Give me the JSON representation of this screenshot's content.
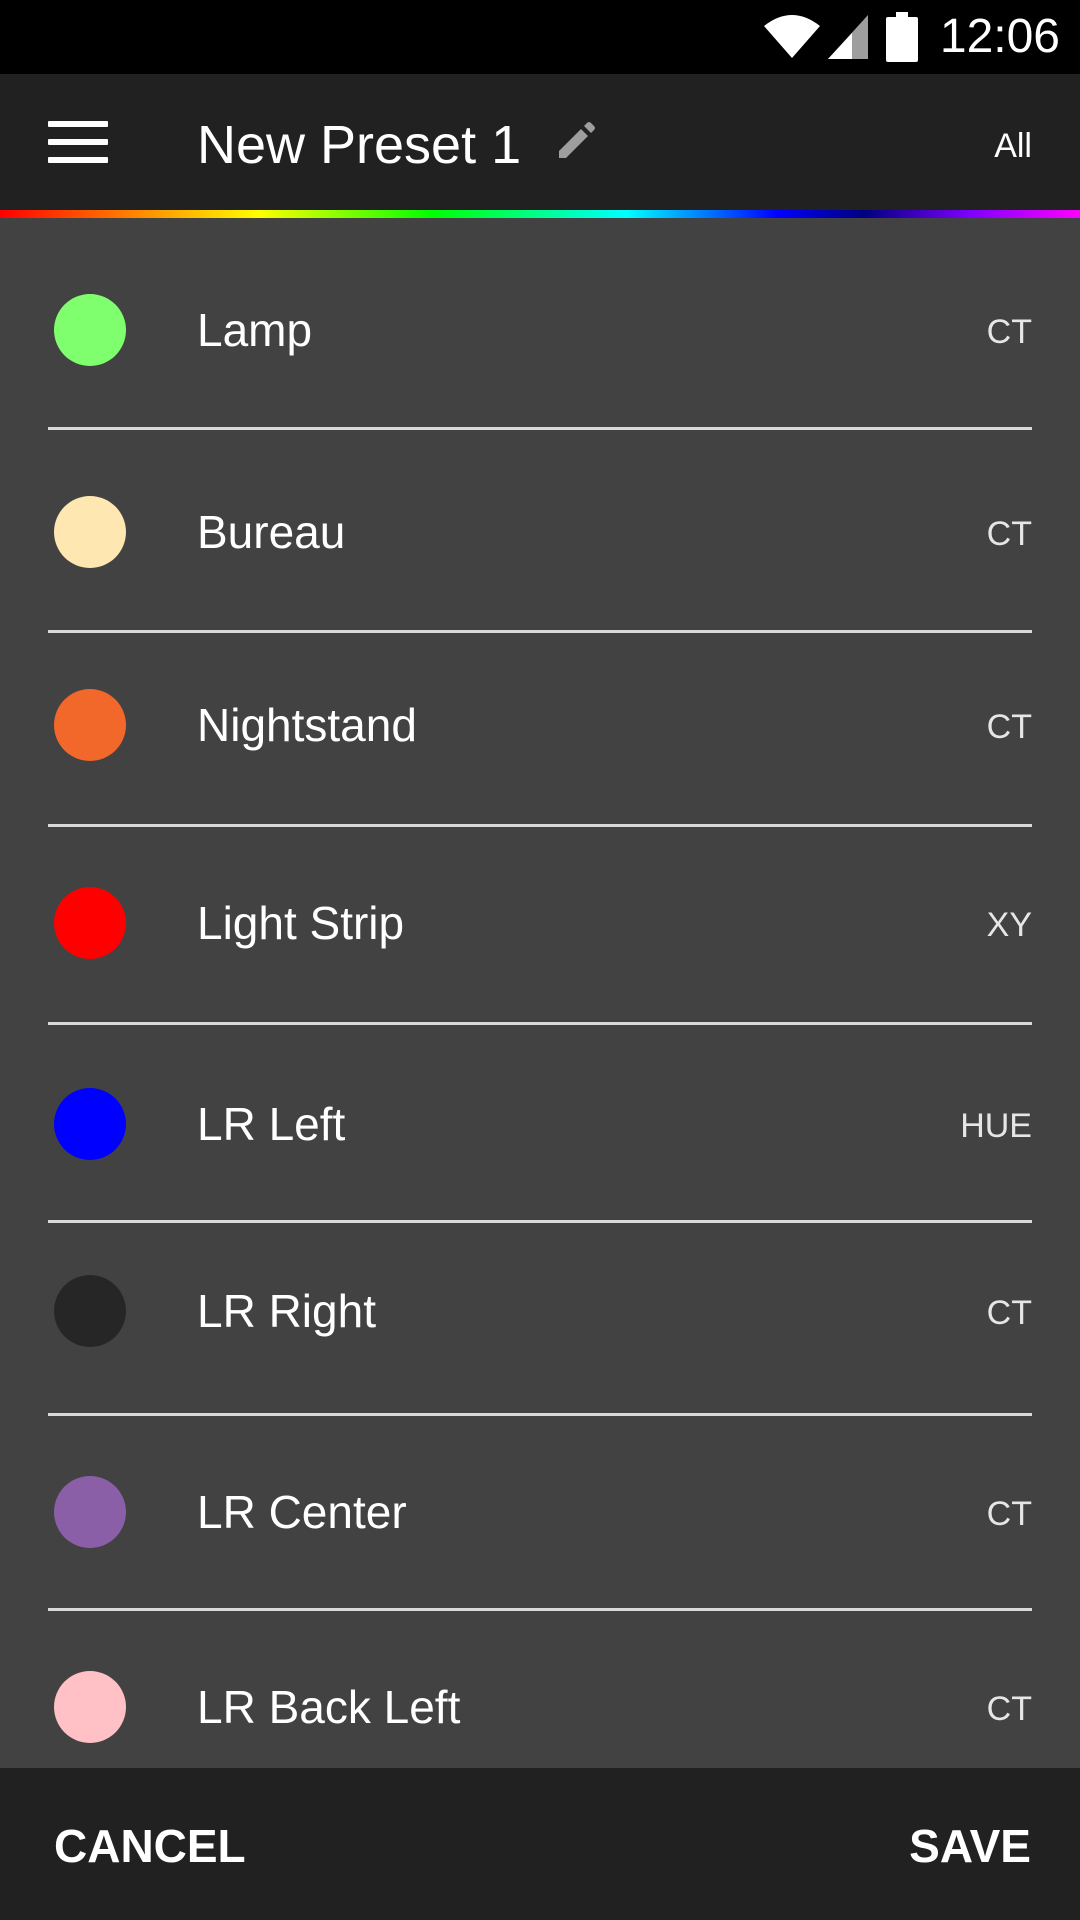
{
  "status_bar": {
    "time": "12:06",
    "icons": [
      "wifi-icon",
      "cell-signal-icon",
      "battery-icon"
    ]
  },
  "app_bar": {
    "menu_icon": "hamburger-menu-icon",
    "title": "New Preset 1",
    "edit_icon": "pencil-icon",
    "filter_label": "All"
  },
  "accent_gradient": [
    "#ff0000",
    "#ff8000",
    "#ffff00",
    "#00ff00",
    "#00ffff",
    "#0000ff",
    "#8000ff",
    "#ff00ff"
  ],
  "lights": [
    {
      "name": "Lamp",
      "mode": "CT",
      "color": "#80ff6e"
    },
    {
      "name": "Bureau",
      "mode": "CT",
      "color": "#ffe7b2"
    },
    {
      "name": "Nightstand",
      "mode": "CT",
      "color": "#f2672a"
    },
    {
      "name": "Light Strip",
      "mode": "XY",
      "color": "#ff0000"
    },
    {
      "name": "LR Left",
      "mode": "HUE",
      "color": "#0000ff"
    },
    {
      "name": "LR Right",
      "mode": "CT",
      "color": "#262626"
    },
    {
      "name": "LR Center",
      "mode": "CT",
      "color": "#8a5fa8"
    },
    {
      "name": "LR Back Left",
      "mode": "CT",
      "color": "#ffc0c6"
    }
  ],
  "actions": {
    "cancel_label": "CANCEL",
    "save_label": "SAVE"
  }
}
